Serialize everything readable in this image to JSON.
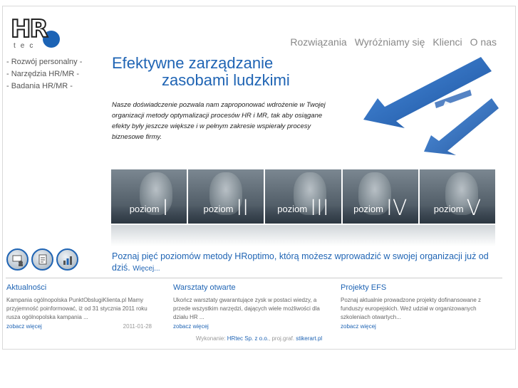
{
  "logo": {
    "mark": "HR",
    "sub": "tec"
  },
  "topnav": [
    "Rozwiązania",
    "Wyróżniamy się",
    "Klienci",
    "O nas"
  ],
  "leftmenu": [
    "- Rozwój personalny -",
    "- Narzędzia HR/MR -",
    "- Badania HR/MR -"
  ],
  "headline": {
    "line1": "Efektywne zarządzanie",
    "line2": "zasobami ludzkimi"
  },
  "intro": "Nasze doświadczenie pozwala nam zaproponować wdrożenie w Twojej organizacji metody optymalizacji procesów HR i MR, tak aby osiągane efekty były jeszcze większe i w pełnym zakresie wspierały procesy biznesowe firmy.",
  "levels": [
    {
      "word": "poziom",
      "num": "I"
    },
    {
      "word": "poziom",
      "num": "II"
    },
    {
      "word": "poziom",
      "num": "III"
    },
    {
      "word": "poziom",
      "num": "IV"
    },
    {
      "word": "poziom",
      "num": "V"
    }
  ],
  "circle_icons": [
    "presentation-icon",
    "document-icon",
    "chart-icon"
  ],
  "lead": {
    "text": "Poznaj pięć poziomów metody HRoptimo, którą możesz wprowadzić w swojej organizacji już od dziś.",
    "more": "Więcej..."
  },
  "columns": [
    {
      "title": "Aktualności",
      "text": "Kampania ogólnopolska PunktObslugiKlienta.pl Mamy przyjemność poinformować, iż od 31 stycznia 2011 roku rusza ogólnopolska kampania ...",
      "link": "zobacz więcej",
      "date": "2011-01-28"
    },
    {
      "title": "Warsztaty otwarte",
      "text": "Ukończ warsztaty gwarantujące zysk w postaci wiedzy, a przede wszystkim narzędzi, dających wiele możliwości dla działu HR ...",
      "link": "zobacz więcej",
      "date": ""
    },
    {
      "title": "Projekty EFS",
      "text": "Poznaj aktualnie prowadzone projekty dofinansowane z funduszy europejskich. Weź udział w organizowanych szkoleniach otwartych...",
      "link": "zobacz więcej",
      "date": ""
    }
  ],
  "footer": {
    "prefix": "Wykonanie:",
    "company": "HRtec Sp. z o.o.",
    "sep": ", proj.graf.",
    "designer": "stikerart.pl"
  },
  "colors": {
    "accent": "#1f64b4",
    "text": "#555555"
  }
}
